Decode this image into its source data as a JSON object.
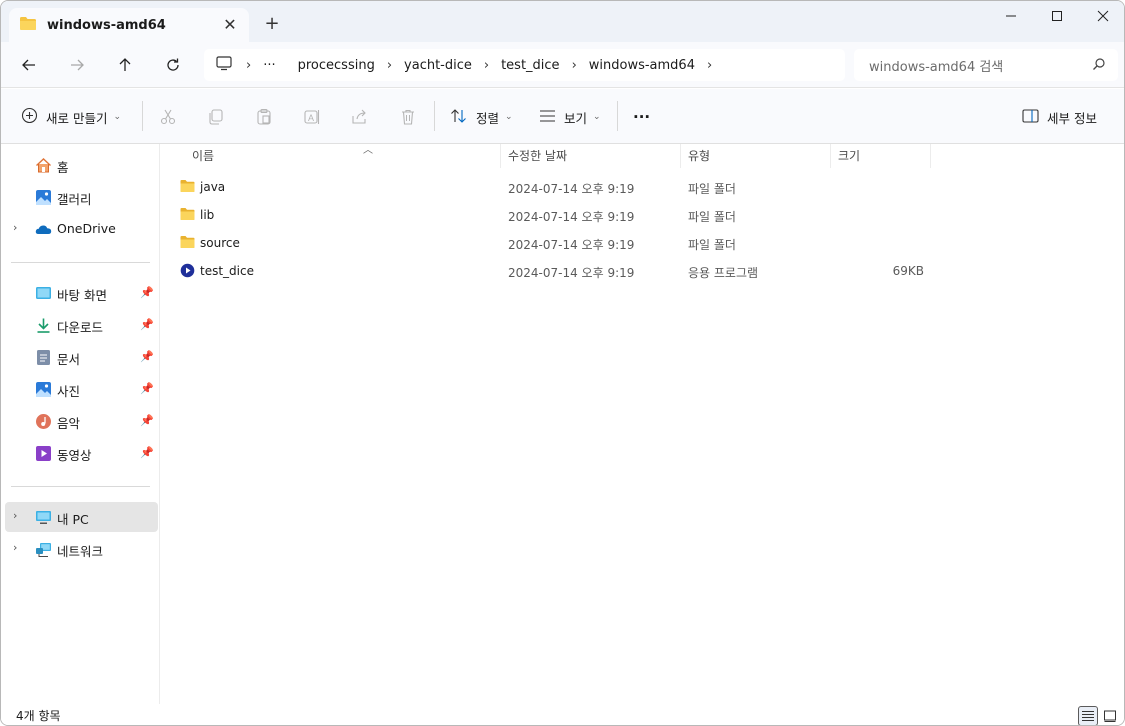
{
  "window": {
    "tab_title": "windows-amd64"
  },
  "breadcrumb": {
    "items": [
      "procecssing",
      "yacht-dice",
      "test_dice",
      "windows-amd64"
    ],
    "overflow": "···"
  },
  "search": {
    "placeholder": "windows-amd64 검색"
  },
  "toolbar": {
    "new_label": "새로 만들기",
    "sort_label": "정렬",
    "view_label": "보기",
    "more_label": "···",
    "details_label": "세부 정보"
  },
  "sidebar": {
    "home": "홈",
    "gallery": "갤러리",
    "onedrive": "OneDrive",
    "pinned": [
      {
        "label": "바탕 화면",
        "icon": "desktop-icon"
      },
      {
        "label": "다운로드",
        "icon": "download-icon"
      },
      {
        "label": "문서",
        "icon": "documents-icon"
      },
      {
        "label": "사진",
        "icon": "pictures-icon"
      },
      {
        "label": "음악",
        "icon": "music-icon"
      },
      {
        "label": "동영상",
        "icon": "videos-icon"
      }
    ],
    "this_pc": "내 PC",
    "network": "네트워크"
  },
  "columns": {
    "name": "이름",
    "date": "수정한 날짜",
    "type": "유형",
    "size": "크기"
  },
  "files": [
    {
      "name": "java",
      "date": "2024-07-14 오후 9:19",
      "type": "파일 폴더",
      "size": "",
      "icon": "folder-icon"
    },
    {
      "name": "lib",
      "date": "2024-07-14 오후 9:19",
      "type": "파일 폴더",
      "size": "",
      "icon": "folder-icon"
    },
    {
      "name": "source",
      "date": "2024-07-14 오후 9:19",
      "type": "파일 폴더",
      "size": "",
      "icon": "folder-icon"
    },
    {
      "name": "test_dice",
      "date": "2024-07-14 오후 9:19",
      "type": "응용 프로그램",
      "size": "69KB",
      "icon": "application-icon"
    }
  ],
  "status": {
    "item_count": "4개 항목"
  },
  "colors": {
    "folder": "#f5c442",
    "accent": "#0067c0",
    "onedrive": "#0f6cbd"
  }
}
